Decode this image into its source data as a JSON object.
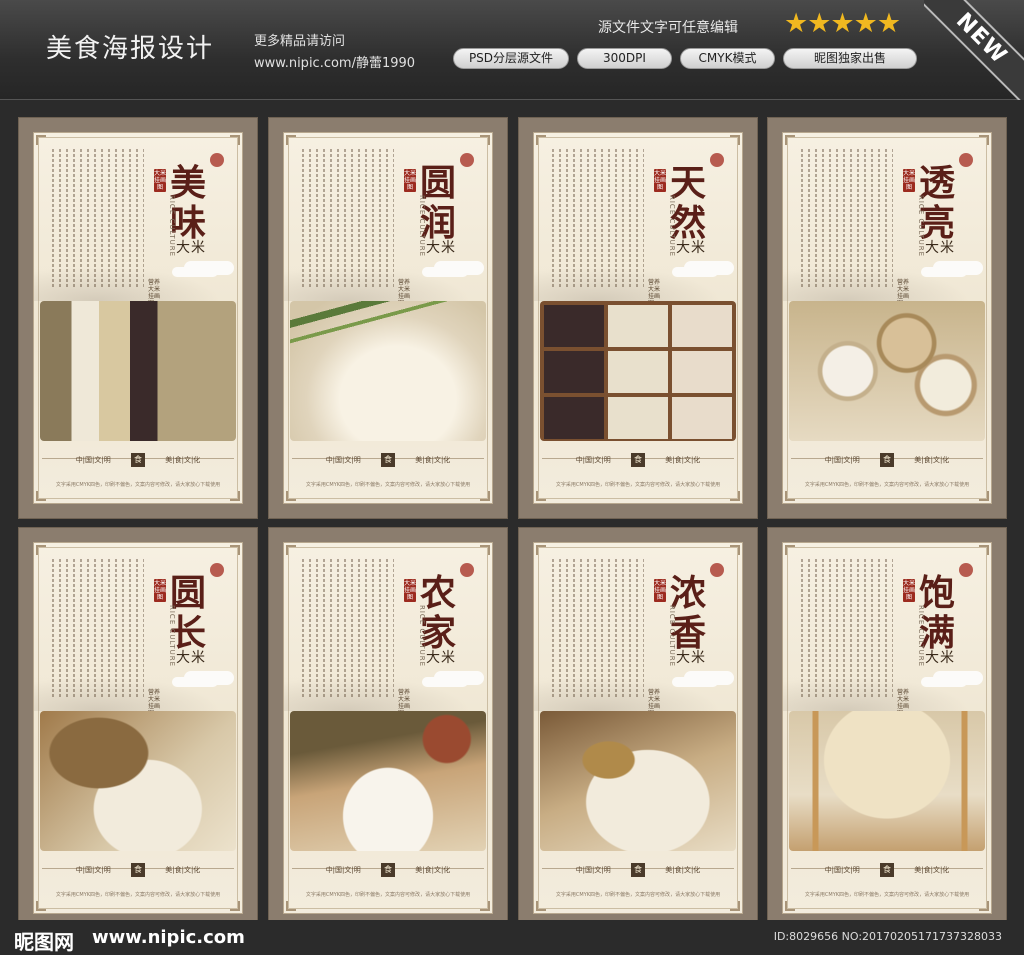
{
  "header": {
    "title": "美食海报设计",
    "more": "更多精品请访问",
    "url": "www.nipic.com/静蕾1990",
    "editable": "源文件文字可任意编辑",
    "stars": "★★★★★",
    "tags": [
      "PSD分层源文件",
      "300DPI",
      "CMYK模式",
      "昵图独家出售"
    ],
    "ribbon": "NEW"
  },
  "posters": [
    {
      "char1": "美",
      "char2": "味",
      "sub": "大米"
    },
    {
      "char1": "圆",
      "char2": "润",
      "sub": "大米"
    },
    {
      "char1": "天",
      "char2": "然",
      "sub": "大米"
    },
    {
      "char1": "透",
      "char2": "亮",
      "sub": "大米"
    },
    {
      "char1": "圆",
      "char2": "长",
      "sub": "大米"
    },
    {
      "char1": "农",
      "char2": "家",
      "sub": "大米"
    },
    {
      "char1": "浓",
      "char2": "香",
      "sub": "大米"
    },
    {
      "char1": "饱",
      "char2": "满",
      "sub": "大米"
    }
  ],
  "poster_common": {
    "culture": "RICE CULTURE",
    "seal": "大米挂画图",
    "signature": "营养大米挂画图",
    "foot_left": "中|国|文|明",
    "foot_badge": "食",
    "foot_right": "美|食|文|化",
    "foot_small": "文字采用CMYK四色，印刷不偏色，文案内容可修改，请大家放心下载使用"
  },
  "footer": {
    "logo": "昵图网",
    "url": "www.nipic.com",
    "id": "ID:8029656 NO:20170205171737328033"
  }
}
